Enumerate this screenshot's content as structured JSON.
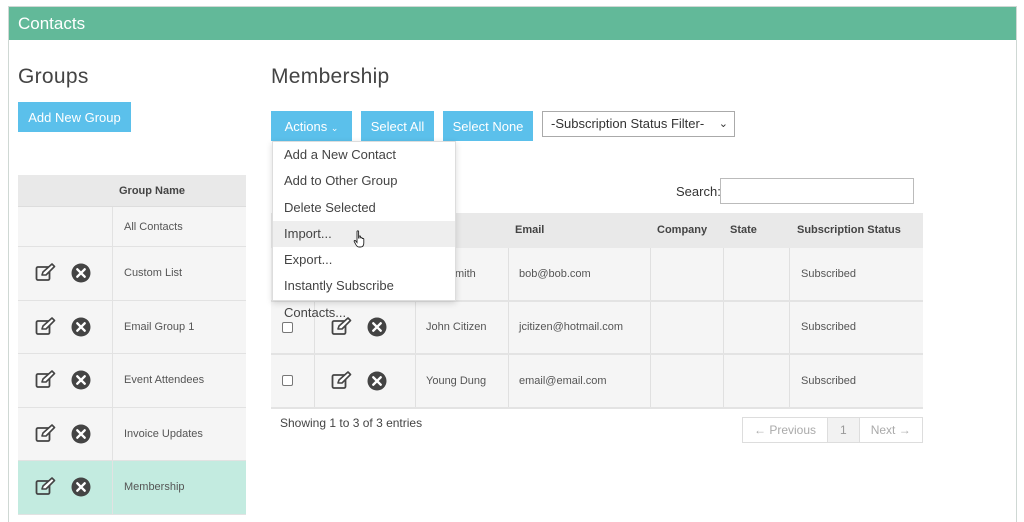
{
  "header": {
    "title": "Contacts"
  },
  "groups": {
    "heading": "Groups",
    "add_button": "Add New Group",
    "column_header": "Group Name",
    "rows": [
      {
        "name": "All Contacts",
        "has_actions": false,
        "active": false
      },
      {
        "name": "Custom List",
        "has_actions": true,
        "active": false
      },
      {
        "name": "Email Group 1",
        "has_actions": true,
        "active": false
      },
      {
        "name": "Event Attendees",
        "has_actions": true,
        "active": false
      },
      {
        "name": "Invoice Updates",
        "has_actions": true,
        "active": false
      },
      {
        "name": "Membership",
        "has_actions": true,
        "active": true
      }
    ]
  },
  "membership": {
    "heading": "Membership",
    "actions_button": "Actions",
    "select_all_button": "Select All",
    "select_none_button": "Select None",
    "filter_select": "-Subscription Status Filter-",
    "actions_menu": [
      "Add a New Contact",
      "Add to Other Group",
      "Delete Selected",
      "Import...",
      "Export...",
      "Instantly Subscribe Contacts..."
    ],
    "hovered_menu_item": "Import...",
    "search_label": "Search:",
    "search_value": "",
    "columns": [
      "Email",
      "Company",
      "State",
      "Subscription Status"
    ],
    "rows": [
      {
        "name": "mith",
        "email": "bob@bob.com",
        "company": "",
        "state": "",
        "status": "Subscribed",
        "partly_hidden": true
      },
      {
        "name": "John Citizen",
        "email": "jcitizen@hotmail.com",
        "company": "",
        "state": "",
        "status": "Subscribed",
        "partly_hidden": false
      },
      {
        "name": "Young Dung",
        "email": "email@email.com",
        "company": "",
        "state": "",
        "status": "Subscribed",
        "partly_hidden": false
      }
    ],
    "info": "Showing 1 to 3 of 3 entries",
    "pager": {
      "previous": "← Previous",
      "current": "1",
      "next": "Next →"
    }
  },
  "colors": {
    "header_bg": "#62b999",
    "button_bg": "#5bc0eb",
    "active_row": "#c3ebe0"
  }
}
